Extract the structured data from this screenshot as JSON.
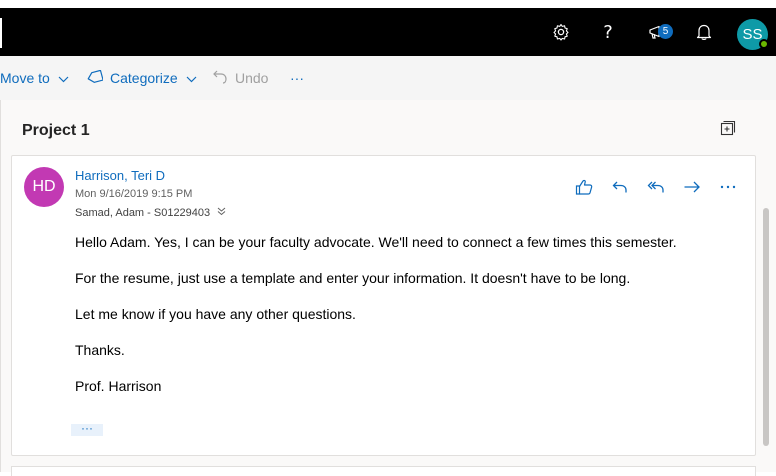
{
  "header": {
    "settings_icon": "gear-icon",
    "help_icon": "question-mark-icon",
    "help_text": "?",
    "whatsnew_icon": "megaphone-icon",
    "whatsnew_badge": "5",
    "notifications_icon": "bell-icon",
    "user_initials": "SS",
    "presence": "available"
  },
  "toolbar": {
    "move_to_label": "Move to",
    "categorize_label": "Categorize",
    "undo_label": "Undo",
    "more_label": "···"
  },
  "conversation": {
    "subject": "Project 1"
  },
  "message": {
    "sender_initials": "HD",
    "sender_name": "Harrison, Teri D",
    "date": "Mon 9/16/2019 9:15 PM",
    "to": "Samad, Adam - S01229403",
    "body": [
      "Hello Adam. Yes, I can be your faculty advocate. We'll need to connect a few times this semester.",
      "For the resume, just use a template and enter your information. It doesn't have to  be long.",
      "Let me know if you have any other questions.",
      "Thanks.",
      "Prof. Harrison"
    ],
    "show_more_label": "···",
    "actions": [
      "like-icon",
      "reply-icon",
      "reply-all-icon",
      "forward-icon",
      "more-icon"
    ]
  },
  "colors": {
    "accent": "#0f6cbd",
    "sender_avatar": "#c239b3",
    "user_avatar": "#0e9aa7",
    "presence": "#6bb700"
  }
}
